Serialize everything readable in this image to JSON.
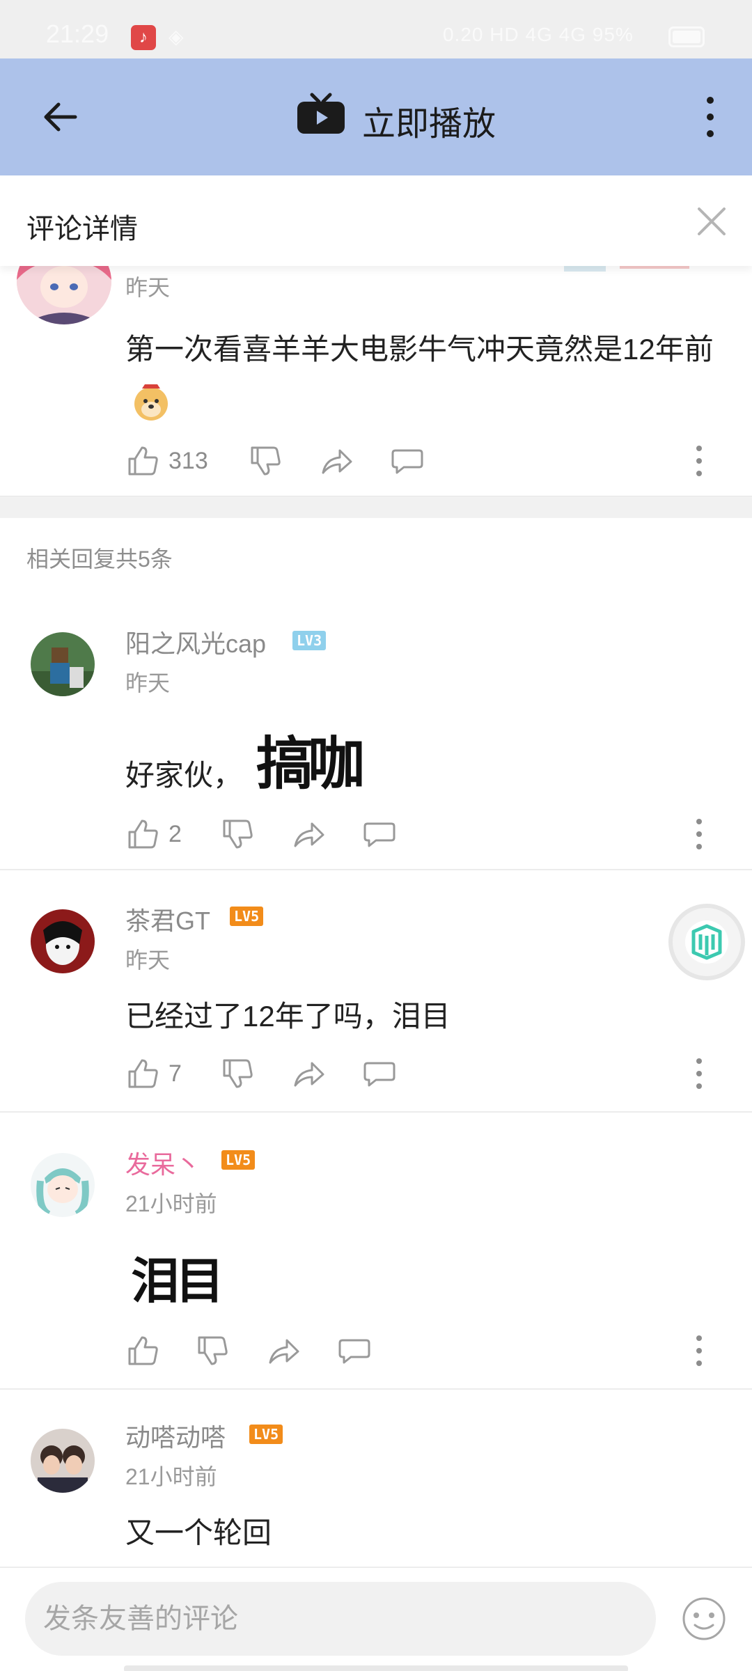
{
  "status_bar": {
    "time": "21:29",
    "network_speed": "0.20 KB/S",
    "right_text": "0.20 HD 4G 4G 95%",
    "battery": "95%"
  },
  "app_bar": {
    "title": "立即播放"
  },
  "panel": {
    "title": "评论详情"
  },
  "main_comment": {
    "time": "昨天",
    "text": "第一次看喜羊羊大电影牛气冲天竟然是12年前",
    "likes": "313"
  },
  "replies_count": "相关回复共5条",
  "replies": [
    {
      "username": "阳之风光cap",
      "level": "LV3",
      "time": "昨天",
      "text": "好家伙，",
      "sticker": "搞咖",
      "likes": "2"
    },
    {
      "username": "茶君GT",
      "level": "LV5",
      "time": "昨天",
      "text": "已经过了12年了吗，泪目",
      "likes": "7"
    },
    {
      "username": "发呆丶",
      "level": "LV5",
      "time": "21小时前",
      "text": "",
      "sticker": "泪目",
      "likes": ""
    },
    {
      "username": "动嗒动嗒",
      "level": "LV5",
      "time": "21小时前",
      "text": "又一个轮回",
      "likes": ""
    }
  ],
  "colors": {
    "app_bar": "#adc2ea",
    "lv3": "#7fc8e8",
    "lv5": "#f28c1a",
    "vip_name": "#e96a9c"
  },
  "bottom": {
    "placeholder": "发条友善的评论"
  },
  "icons": [
    "back-arrow-icon",
    "tv-icon",
    "more-vertical-icon",
    "close-icon",
    "thumb-up-icon",
    "thumb-down-icon",
    "share-icon",
    "comment-icon",
    "emoji-icon"
  ]
}
